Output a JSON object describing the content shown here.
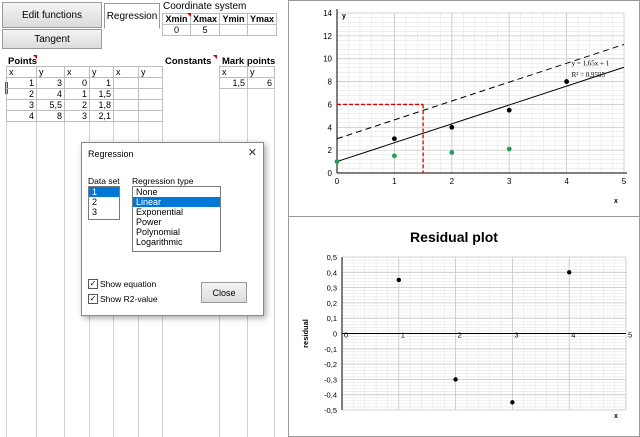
{
  "toolbar": {
    "edit_functions": "Edit functions",
    "regression": "Regression",
    "tangent": "Tangent"
  },
  "coord": {
    "title": "Coordinate system",
    "headers": [
      "Xmin",
      "Xmax",
      "Ymin",
      "Ymax"
    ],
    "values": [
      "0",
      "5",
      "",
      ""
    ]
  },
  "sections": {
    "points": "Points",
    "constants": "Constants",
    "mark_points": "Mark points"
  },
  "points": {
    "headers": [
      "x",
      "y",
      "x",
      "y",
      "x",
      "y"
    ],
    "rows": [
      [
        "1",
        "3",
        "0",
        "1",
        "",
        ""
      ],
      [
        "2",
        "4",
        "1",
        "1,5",
        "",
        ""
      ],
      [
        "3",
        "5,5",
        "2",
        "1,8",
        "",
        ""
      ],
      [
        "4",
        "8",
        "3",
        "2,1",
        "",
        ""
      ]
    ]
  },
  "mark_points": {
    "headers": [
      "x",
      "y"
    ],
    "row": [
      "1,5",
      "6"
    ]
  },
  "dialog": {
    "title": "Regression",
    "close_x": "✕",
    "data_set_label": "Data set",
    "data_sets": [
      "1",
      "2",
      "3"
    ],
    "data_set_selected": "1",
    "regression_type_label": "Regression type",
    "types": [
      "None",
      "Linear",
      "Exponential",
      "Power",
      "Polynomial",
      "Logarithmic"
    ],
    "type_selected": "Linear",
    "show_equation": "Show equation",
    "show_r2": "Show R2-value",
    "show_equation_checked": true,
    "show_r2_checked": true,
    "close_button": "Close"
  },
  "chart_data": [
    {
      "type": "scatter",
      "title": "",
      "xlabel": "x",
      "ylabel": "y",
      "xlim": [
        0,
        5
      ],
      "ylim": [
        0,
        14
      ],
      "xticks": [
        "0",
        "1",
        "2",
        "3",
        "4",
        "5"
      ],
      "yticks": [
        "0",
        "2",
        "4",
        "6",
        "8",
        "10",
        "12",
        "14"
      ],
      "grid": true,
      "series": [
        {
          "points": [
            [
              1,
              3
            ],
            [
              2,
              4
            ],
            [
              3,
              5.5
            ],
            [
              4,
              8
            ]
          ],
          "color": "#000000"
        },
        {
          "points": [
            [
              0,
              1
            ],
            [
              1,
              1.5
            ],
            [
              2,
              1.8
            ],
            [
              3,
              2.1
            ]
          ],
          "color": "#1fa05a"
        }
      ],
      "regression_line": {
        "slope": 1.65,
        "intercept": 1,
        "color": "#000000"
      },
      "dashed_line": {
        "slope": 1.65,
        "intercept": 3,
        "color": "#000000"
      },
      "mark_point": {
        "x": 1.5,
        "y": 6,
        "color": "#e00000"
      },
      "annotation": {
        "equation": "y = 1,65x + 1",
        "r2": "R² = 0,9595"
      }
    },
    {
      "type": "scatter",
      "title": "Residual plot",
      "xlabel": "x",
      "ylabel": "residual",
      "xlim": [
        0,
        5
      ],
      "ylim": [
        -0.5,
        0.5
      ],
      "xticks": [
        "0",
        "1",
        "2",
        "3",
        "4",
        "5"
      ],
      "yticks": [
        "0,5",
        "0,4",
        "0,3",
        "0,2",
        "0,1",
        "0",
        "-0,1",
        "-0,2",
        "-0,3",
        "-0,4",
        "-0,5"
      ],
      "grid": true,
      "series": [
        {
          "points": [
            [
              1,
              0.35
            ],
            [
              2,
              -0.3
            ],
            [
              3,
              -0.45
            ],
            [
              4,
              0.4
            ]
          ],
          "color": "#000000"
        }
      ]
    }
  ]
}
